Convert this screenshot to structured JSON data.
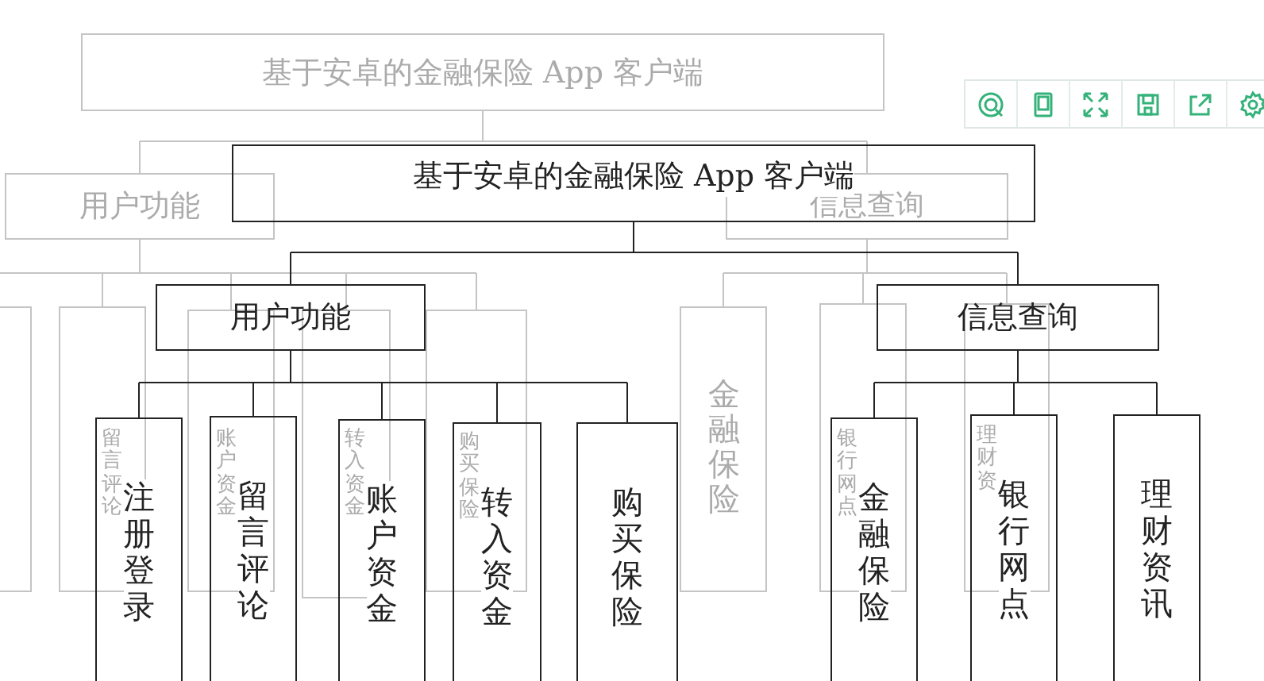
{
  "background_diagram": {
    "root": "基于安卓的金融保险 App 客户端",
    "branches": [
      {
        "label": "用户功能",
        "children": [
          "留言评论",
          "账户资金",
          "转入资金",
          "购买保险"
        ]
      },
      {
        "label": "信息查询",
        "children": [
          "金融保险",
          "银行网点",
          "理财资"
        ]
      }
    ]
  },
  "diagram": {
    "root": "基于安卓的金融保险 App 客户端",
    "branches": [
      {
        "label": "用户功能",
        "children": [
          "注册登录",
          "留言评论",
          "账户资金",
          "转入资金",
          "购买保险"
        ]
      },
      {
        "label": "信息查询",
        "children": [
          "金融保险",
          "银行网点",
          "理财资讯"
        ]
      }
    ]
  }
}
